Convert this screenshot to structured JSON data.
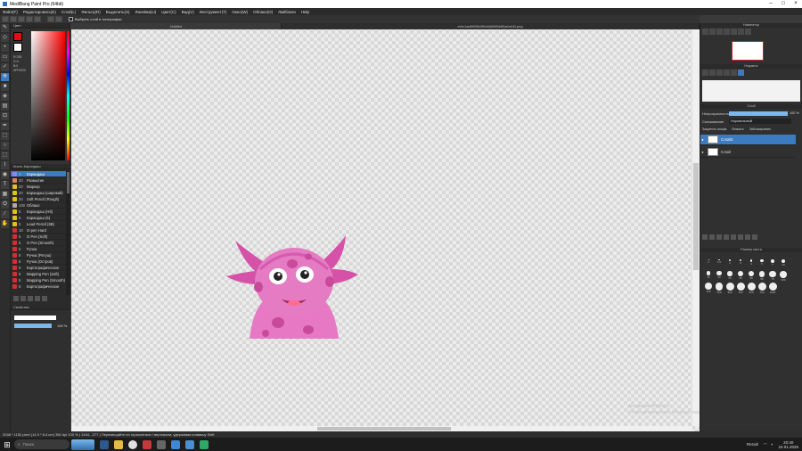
{
  "window": {
    "title": "MediBang Paint Pro (64bit)",
    "controls": [
      "–",
      "□",
      "×"
    ]
  },
  "menu": [
    "Файл(F)",
    "Редактировать(E)",
    "Слой(L)",
    "Фильтр(R)",
    "Выделить(S)",
    "Линейка(U)",
    "Цвет(C)",
    "Вид(V)",
    "Инструмент(T)",
    "Окно(W)",
    "Облако(O)",
    "Лайблаги",
    "Help"
  ],
  "toolbar": {
    "auto_select_label": "Выбрать слой в типографии"
  },
  "colors": {
    "foreground": "#e01010",
    "background": "#ffffff",
    "accent": "#3b7bbf"
  },
  "color_panel": {
    "title": "Цвет",
    "values": [
      "R:255",
      "G:0",
      "B:0",
      "#FF0000"
    ]
  },
  "brush_panel": {
    "title": "Кисть Карандаш",
    "items": [
      {
        "size": "3",
        "name": "Карандаш",
        "color": "#8888ee"
      },
      {
        "size": "20",
        "name": "Размытие",
        "color": "#e08060"
      },
      {
        "size": "20",
        "name": "Маркер",
        "color": "#e0c020"
      },
      {
        "size": "20",
        "name": "Карандаш (широкий)",
        "color": "#e0c020"
      },
      {
        "size": "20",
        "name": "Soft Pencil (Rough)",
        "color": "#e0c020"
      },
      {
        "size": "100",
        "name": "Облако",
        "color": "#aaaaaa"
      },
      {
        "size": "5",
        "name": "Карандаш (Нб)",
        "color": "#e0c020"
      },
      {
        "size": "5",
        "name": "Карандаш (6)",
        "color": "#e0c020"
      },
      {
        "size": "5",
        "name": "Lead Pencil (6B)",
        "color": "#e0c020"
      },
      {
        "size": "10",
        "name": "G-pen Hard",
        "color": "#d03030"
      },
      {
        "size": "5",
        "name": "G Pen (Soft)",
        "color": "#d03030"
      },
      {
        "size": "5",
        "name": "G Pen (Smooth)",
        "color": "#d03030"
      },
      {
        "size": "5",
        "name": "Ручка",
        "color": "#d03030"
      },
      {
        "size": "8",
        "name": "Ручка (Ретуш)",
        "color": "#d03030"
      },
      {
        "size": "8",
        "name": "Ручка (Остров)",
        "color": "#d03030"
      },
      {
        "size": "8",
        "name": "Картографическое",
        "color": "#d03030"
      },
      {
        "size": "8",
        "name": "Mapping Pen (Soft)",
        "color": "#d03030"
      },
      {
        "size": "8",
        "name": "Mapping Pen (Smooth)",
        "color": "#d03030"
      },
      {
        "size": "8",
        "name": "Картографическое",
        "color": "#d03030"
      }
    ]
  },
  "properties_panel": {
    "title": "Свойства",
    "opacity_value": "100 %"
  },
  "tabs": [
    "Untitled",
    "eefc1ad6905b0f0e8d06f9d4f6a1efd0.png"
  ],
  "navigator": {
    "title": "Навигатор"
  },
  "material_panel": {
    "title": "Недавно"
  },
  "layer_panel": {
    "title": "Слой",
    "opacity_label": "Непрозрачность",
    "opacity_value": "100 %",
    "opacity_fraction": 1.0,
    "blend_label": "Смешивание",
    "blend_value": "Нормальный",
    "checks": [
      "Защитить альфа",
      "Вписать",
      "Заблокировать"
    ],
    "layers": [
      {
        "name": "Слой2",
        "selected": true
      },
      {
        "name": "Слой",
        "selected": false
      }
    ]
  },
  "brush_size_panel": {
    "title": "Размер кисти",
    "sizes": [
      "1",
      "1.5",
      "2",
      "3",
      "4",
      "5",
      "7",
      "10",
      "15",
      "20",
      "25",
      "30",
      "40",
      "50",
      "70",
      "100",
      "150",
      "200",
      "300",
      "400",
      "500",
      "700",
      "1000"
    ]
  },
  "watermark": {
    "line1": "Активация Windows",
    "line2": "Чтобы активировать Windows, перейдите в раздел \"Параметры\"."
  },
  "status_bar": {
    "text": "2048 * 1152 pixel   (14.9 * 8.4 cm)   350 dpi   100 %   ( 1444, -377 )   Перемещайте по горизонтали / вертикали, удерживая клавишу Shift"
  },
  "taskbar": {
    "search_placeholder": "Поиск",
    "weather": "Rezult",
    "time": "20:40",
    "date": "24.01.2025"
  }
}
